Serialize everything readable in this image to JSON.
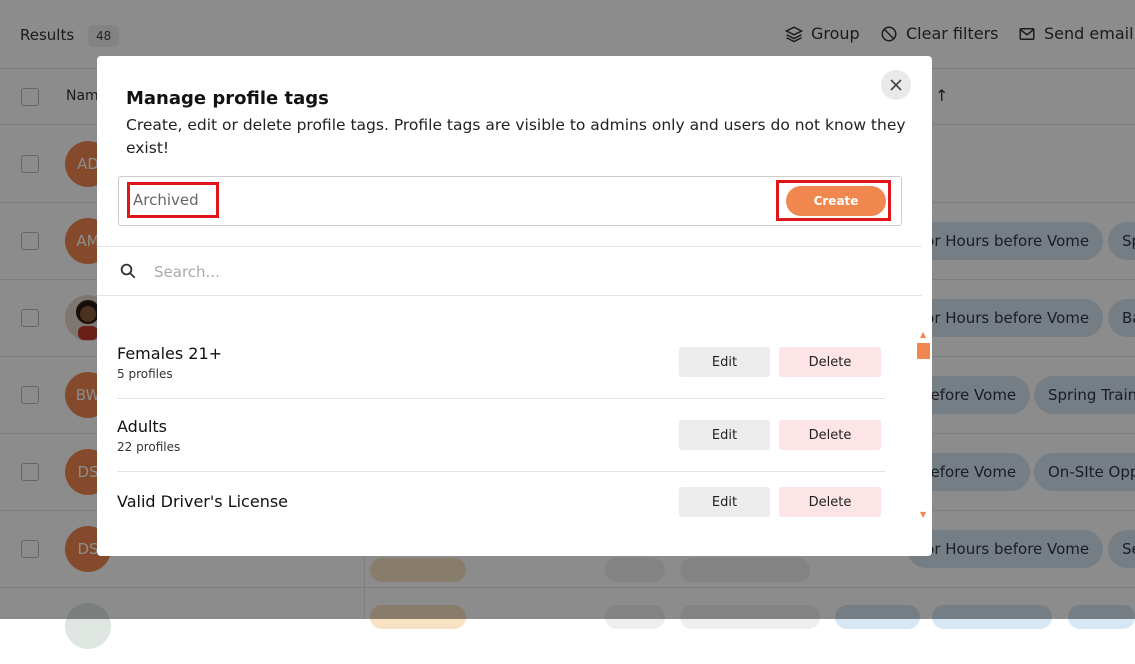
{
  "background": {
    "results_label": "Results",
    "results_count": "48",
    "toolbar": {
      "group": "Group",
      "clear_filters": "Clear filters",
      "send_email": "Send email"
    },
    "header_name": "Nam",
    "sort_arrow": "↑",
    "rows": [
      {
        "initials": "AD",
        "pills": []
      },
      {
        "initials": "AM",
        "pills": [
          "ior Hours before Vome",
          "Sp"
        ]
      },
      {
        "initials": "",
        "pills": [
          "ior Hours before Vome",
          "Ba"
        ]
      },
      {
        "initials": "BW",
        "pills": [
          "before Vome",
          "Spring Traini"
        ]
      },
      {
        "initials": "DS",
        "pills": [
          "before Vome",
          "On-SIte Opp"
        ]
      },
      {
        "initials": "DS",
        "pills": [
          "ior Hours before Vome",
          "Se"
        ]
      }
    ]
  },
  "modal": {
    "title": "Manage profile tags",
    "description": "Create, edit or delete profile tags. Profile tags are visible to admins only and users do not know they exist!",
    "tag_input_value": "Archived",
    "create_label": "Create",
    "search_placeholder": "Search...",
    "tags": [
      {
        "name": "Females 21+",
        "count": "5 profiles"
      },
      {
        "name": "Adults",
        "count": "22 profiles"
      },
      {
        "name": "Valid Driver's License",
        "count": ""
      }
    ],
    "edit_label": "Edit",
    "delete_label": "Delete"
  },
  "colors": {
    "accent": "#f0874f",
    "highlight": "#e0141b",
    "pill": "#d6e6f2",
    "delete_bg": "#fde4e7"
  }
}
